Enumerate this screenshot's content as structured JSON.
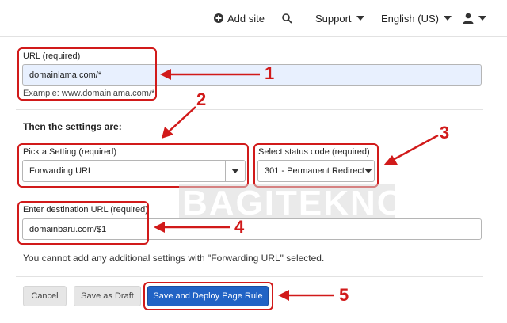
{
  "nav": {
    "add_site": "Add site",
    "support": "Support",
    "language": "English (US)"
  },
  "url_field": {
    "label": "URL (required)",
    "value": "domainlama.com/*",
    "example": "Example: www.domainlama.com/*"
  },
  "settings": {
    "heading": "Then the settings are:",
    "setting_label": "Pick a Setting (required)",
    "setting_value": "Forwarding URL",
    "status_label": "Select status code (required)",
    "status_value": "301 - Permanent Redirect",
    "dest_label": "Enter destination URL (required)",
    "dest_value": "domainbaru.com/$1",
    "note": "You cannot add any additional settings with \"Forwarding URL\" selected."
  },
  "buttons": {
    "cancel": "Cancel",
    "draft": "Save as Draft",
    "deploy": "Save and Deploy Page Rule"
  },
  "annotations": [
    "1",
    "2",
    "3",
    "4",
    "5"
  ],
  "watermark": "BAGITEKNO",
  "colors": {
    "annotation": "#d11a1a",
    "primary_button": "#2163c5",
    "active_input": "#e8f0fe"
  }
}
